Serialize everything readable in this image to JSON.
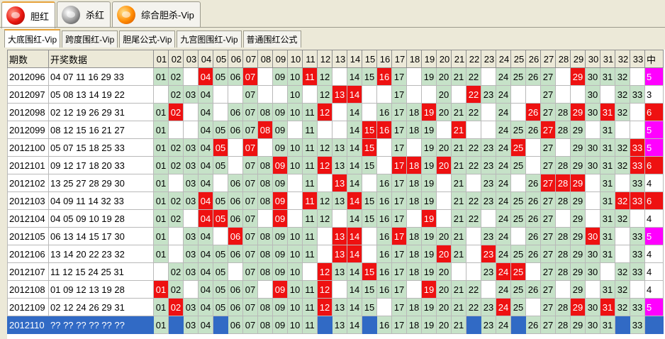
{
  "top_tabs": [
    {
      "label": "胆红",
      "icon": "red-ball-icon",
      "active": true
    },
    {
      "label": "杀红",
      "icon": "gray-ball-icon",
      "active": false
    },
    {
      "label": "综合胆杀-Vip",
      "icon": "orange-ball-icon",
      "active": false
    }
  ],
  "sub_tabs": [
    {
      "label": "大底围红-Vip",
      "active": true
    },
    {
      "label": "跨度围红-Vip",
      "active": false
    },
    {
      "label": "胆尾公式-Vip",
      "active": false
    },
    {
      "label": "九宫图围红-Vip",
      "active": false
    },
    {
      "label": "普通围红公式",
      "active": false
    }
  ],
  "table": {
    "headers": {
      "period": "期数",
      "draw": "开奖数据",
      "numbers": [
        "01",
        "02",
        "03",
        "04",
        "05",
        "06",
        "07",
        "08",
        "09",
        "10",
        "11",
        "12",
        "13",
        "14",
        "15",
        "16",
        "17",
        "18",
        "19",
        "20",
        "21",
        "22",
        "23",
        "24",
        "25",
        "26",
        "27",
        "28",
        "29",
        "30",
        "31",
        "32",
        "33"
      ],
      "hit": "中"
    },
    "rows": [
      {
        "period": "2012096",
        "draw": "04 07 11 16 29 33",
        "nums": [
          "01",
          "02",
          "04",
          "05",
          "06",
          "07",
          "09",
          "10",
          "11",
          "12",
          "14",
          "15",
          "16",
          "17",
          "19",
          "20",
          "21",
          "22",
          "24",
          "25",
          "26",
          "27",
          "29",
          "30",
          "31",
          "32"
        ],
        "hits": [
          "04",
          "07",
          "11",
          "16",
          "29"
        ],
        "hit_count": "5",
        "hit_style": "mag"
      },
      {
        "period": "2012097",
        "draw": "05 08 13 14 19 22",
        "nums": [
          "02",
          "03",
          "04",
          "07",
          "10",
          "12",
          "13",
          "14",
          "17",
          "20",
          "22",
          "23",
          "24",
          "27",
          "30",
          "32",
          "33"
        ],
        "hits": [
          "13",
          "14",
          "22"
        ],
        "hit_count": "3",
        "hit_style": "plain"
      },
      {
        "period": "2012098",
        "draw": "02 12 19 26 29 31",
        "nums": [
          "01",
          "02",
          "04",
          "06",
          "07",
          "08",
          "09",
          "10",
          "11",
          "12",
          "14",
          "16",
          "17",
          "18",
          "19",
          "20",
          "21",
          "22",
          "24",
          "26",
          "27",
          "28",
          "29",
          "30",
          "31",
          "32"
        ],
        "hits": [
          "02",
          "12",
          "19",
          "26",
          "29",
          "31"
        ],
        "hit_count": "6",
        "hit_style": "red"
      },
      {
        "period": "2012099",
        "draw": "08 12 15 16 21 27",
        "nums": [
          "01",
          "04",
          "05",
          "06",
          "07",
          "08",
          "09",
          "11",
          "14",
          "15",
          "16",
          "17",
          "18",
          "19",
          "21",
          "24",
          "25",
          "26",
          "27",
          "28",
          "29",
          "31"
        ],
        "hits": [
          "08",
          "15",
          "16",
          "21",
          "27"
        ],
        "hit_count": "5",
        "hit_style": "mag"
      },
      {
        "period": "2012100",
        "draw": "05 07 15 18 25 33",
        "nums": [
          "01",
          "02",
          "03",
          "04",
          "05",
          "07",
          "09",
          "10",
          "11",
          "12",
          "13",
          "14",
          "15",
          "17",
          "19",
          "20",
          "21",
          "22",
          "23",
          "24",
          "25",
          "27",
          "29",
          "30",
          "31",
          "32",
          "33"
        ],
        "hits": [
          "05",
          "07",
          "15",
          "25",
          "33"
        ],
        "hit_count": "5",
        "hit_style": "mag"
      },
      {
        "period": "2012101",
        "draw": "09 12 17 18 20 33",
        "nums": [
          "01",
          "02",
          "03",
          "04",
          "05",
          "07",
          "08",
          "09",
          "10",
          "11",
          "12",
          "13",
          "14",
          "15",
          "17",
          "18",
          "19",
          "20",
          "21",
          "22",
          "23",
          "24",
          "25",
          "27",
          "28",
          "29",
          "30",
          "31",
          "32",
          "33"
        ],
        "hits": [
          "09",
          "12",
          "17",
          "18",
          "20",
          "33"
        ],
        "hit_count": "6",
        "hit_style": "red"
      },
      {
        "period": "2012102",
        "draw": "13 25 27 28 29 30",
        "nums": [
          "01",
          "03",
          "04",
          "06",
          "07",
          "08",
          "09",
          "11",
          "13",
          "14",
          "16",
          "17",
          "18",
          "19",
          "21",
          "23",
          "24",
          "26",
          "27",
          "28",
          "29",
          "31",
          "33"
        ],
        "hits": [
          "13",
          "27",
          "28",
          "29"
        ],
        "hit_count": "4",
        "hit_style": "plain"
      },
      {
        "period": "2012103",
        "draw": "04 09 11 14 32 33",
        "nums": [
          "01",
          "02",
          "03",
          "04",
          "05",
          "06",
          "07",
          "08",
          "09",
          "11",
          "12",
          "13",
          "14",
          "15",
          "16",
          "17",
          "18",
          "19",
          "21",
          "22",
          "23",
          "24",
          "25",
          "26",
          "27",
          "28",
          "29",
          "31",
          "32",
          "33"
        ],
        "hits": [
          "04",
          "09",
          "11",
          "14",
          "32",
          "33"
        ],
        "hit_count": "6",
        "hit_style": "red"
      },
      {
        "period": "2012104",
        "draw": "04 05 09 10 19 28",
        "nums": [
          "01",
          "02",
          "04",
          "05",
          "06",
          "07",
          "09",
          "11",
          "12",
          "14",
          "15",
          "16",
          "17",
          "19",
          "21",
          "22",
          "24",
          "25",
          "26",
          "27",
          "29",
          "31",
          "32"
        ],
        "hits": [
          "04",
          "05",
          "09",
          "19"
        ],
        "hit_count": "4",
        "hit_style": "plain"
      },
      {
        "period": "2012105",
        "draw": "06 13 14 15 17 30",
        "nums": [
          "01",
          "03",
          "04",
          "06",
          "07",
          "08",
          "09",
          "10",
          "11",
          "13",
          "14",
          "16",
          "17",
          "18",
          "19",
          "20",
          "21",
          "23",
          "24",
          "26",
          "27",
          "28",
          "29",
          "30",
          "31",
          "33"
        ],
        "hits": [
          "06",
          "13",
          "14",
          "17",
          "30"
        ],
        "hit_count": "5",
        "hit_style": "mag"
      },
      {
        "period": "2012106",
        "draw": "13 14 20 22 23 32",
        "nums": [
          "01",
          "03",
          "04",
          "05",
          "06",
          "07",
          "08",
          "09",
          "10",
          "11",
          "13",
          "14",
          "16",
          "17",
          "18",
          "19",
          "20",
          "21",
          "23",
          "24",
          "25",
          "26",
          "27",
          "28",
          "29",
          "30",
          "31",
          "33"
        ],
        "hits": [
          "13",
          "14",
          "20",
          "23"
        ],
        "hit_count": "4",
        "hit_style": "plain"
      },
      {
        "period": "2012107",
        "draw": "11 12 15 24 25 31",
        "nums": [
          "02",
          "03",
          "04",
          "05",
          "07",
          "08",
          "09",
          "10",
          "12",
          "13",
          "14",
          "15",
          "16",
          "17",
          "18",
          "19",
          "20",
          "23",
          "24",
          "25",
          "27",
          "28",
          "29",
          "30",
          "32",
          "33"
        ],
        "hits": [
          "12",
          "15",
          "24",
          "25"
        ],
        "hit_count": "4",
        "hit_style": "plain"
      },
      {
        "period": "2012108",
        "draw": "01 09 12 13 19 28",
        "nums": [
          "01",
          "02",
          "04",
          "05",
          "06",
          "07",
          "09",
          "10",
          "11",
          "12",
          "14",
          "15",
          "16",
          "17",
          "19",
          "20",
          "21",
          "22",
          "24",
          "25",
          "26",
          "27",
          "29",
          "31",
          "32"
        ],
        "hits": [
          "01",
          "09",
          "12",
          "19"
        ],
        "hit_count": "4",
        "hit_style": "plain"
      },
      {
        "period": "2012109",
        "draw": "02 12 24 26 29 31",
        "nums": [
          "01",
          "02",
          "03",
          "04",
          "05",
          "06",
          "07",
          "08",
          "09",
          "10",
          "11",
          "12",
          "13",
          "14",
          "15",
          "17",
          "18",
          "19",
          "20",
          "21",
          "22",
          "23",
          "24",
          "25",
          "27",
          "28",
          "29",
          "30",
          "31",
          "32",
          "33"
        ],
        "hits": [
          "02",
          "12",
          "24",
          "29",
          "31"
        ],
        "hit_count": "5",
        "hit_style": "mag"
      },
      {
        "period": "2012110",
        "draw": "?? ?? ?? ?? ?? ??",
        "nums": [
          "01",
          "03",
          "04",
          "06",
          "07",
          "08",
          "09",
          "10",
          "11",
          "13",
          "14",
          "16",
          "17",
          "18",
          "19",
          "20",
          "21",
          "23",
          "24",
          "26",
          "27",
          "28",
          "29",
          "30",
          "31",
          "33"
        ],
        "hits": [],
        "hit_count": "",
        "hit_style": "plain",
        "selected": true
      }
    ]
  },
  "colors": {
    "candidate": "#c6e2c8",
    "hit": "#ee1111",
    "five_hits": "#ff00ff",
    "selection": "#316ac5"
  }
}
